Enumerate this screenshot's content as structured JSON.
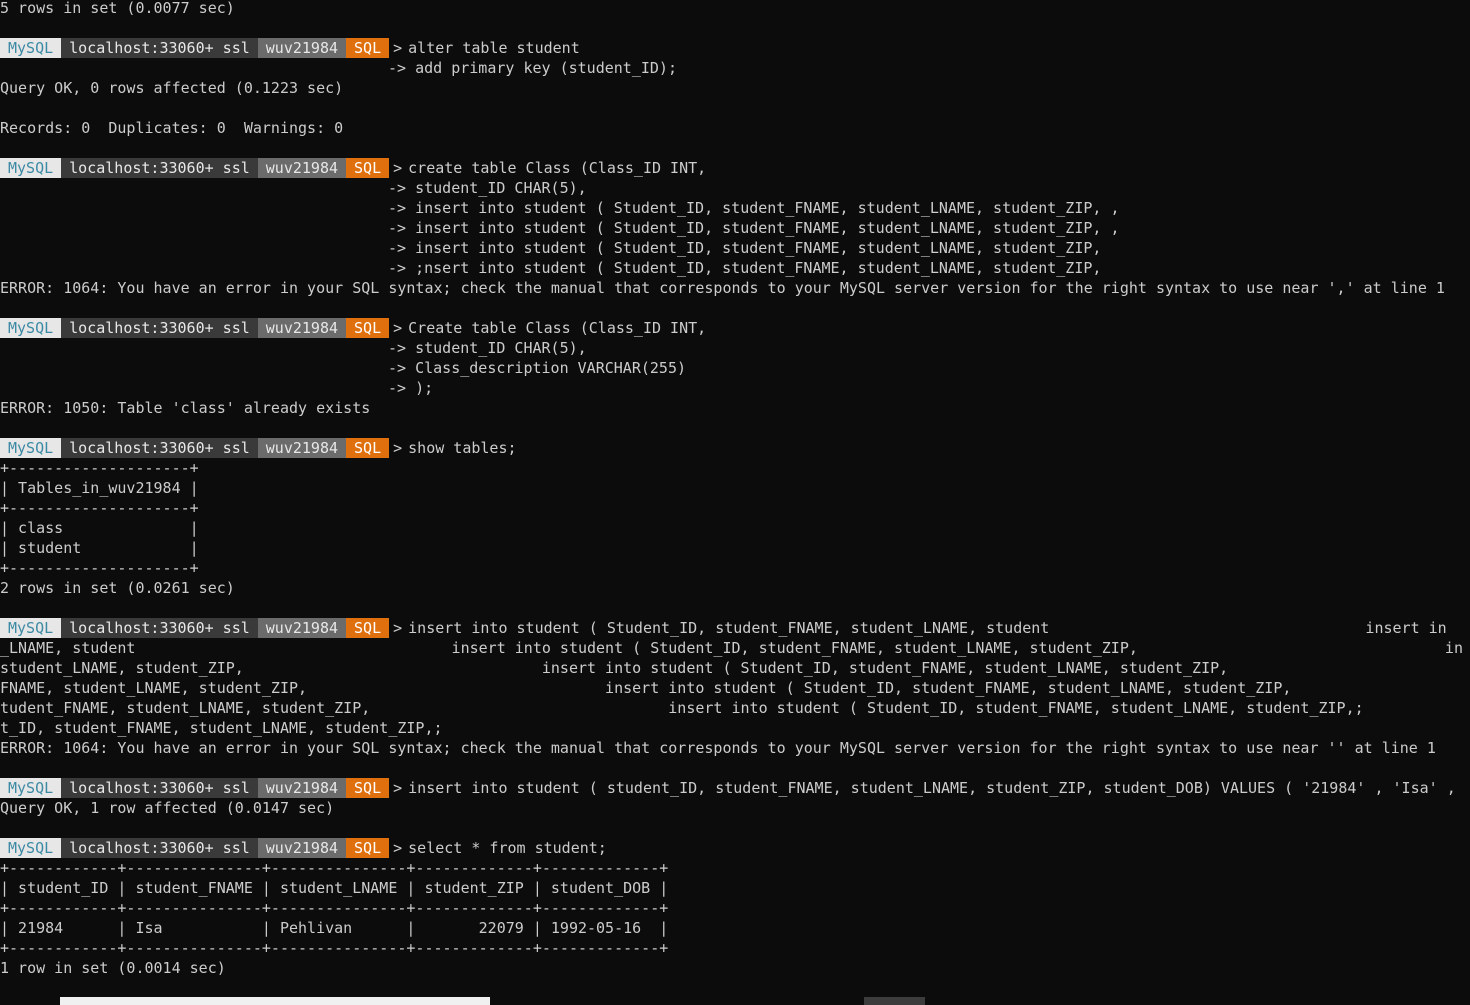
{
  "prompt": {
    "mysql": "MySQL",
    "host": "localhost:33060+ ssl",
    "schema": "wuv21984",
    "mode": "SQL",
    "arrow": ">"
  },
  "lines": [
    {
      "kind": "text",
      "text": "5 rows in set (0.0077 sec)"
    },
    {
      "kind": "blank"
    },
    {
      "kind": "prompt",
      "text": "alter table student"
    },
    {
      "kind": "cont",
      "text": "-> add primary key (student_ID);"
    },
    {
      "kind": "text",
      "text": "Query OK, 0 rows affected (0.1223 sec)"
    },
    {
      "kind": "blank"
    },
    {
      "kind": "text",
      "text": "Records: 0  Duplicates: 0  Warnings: 0"
    },
    {
      "kind": "blank"
    },
    {
      "kind": "prompt",
      "text": "create table Class (Class_ID INT,"
    },
    {
      "kind": "cont",
      "text": "-> student_ID CHAR(5),"
    },
    {
      "kind": "cont",
      "text": "-> insert into student ( Student_ID, student_FNAME, student_LNAME, student_ZIP, ,"
    },
    {
      "kind": "cont",
      "text": "-> insert into student ( Student_ID, student_FNAME, student_LNAME, student_ZIP, ,"
    },
    {
      "kind": "cont",
      "text": "-> insert into student ( Student_ID, student_FNAME, student_LNAME, student_ZIP,"
    },
    {
      "kind": "cont",
      "text": "-> ;nsert into student ( Student_ID, student_FNAME, student_LNAME, student_ZIP,"
    },
    {
      "kind": "text",
      "text": "ERROR: 1064: You have an error in your SQL syntax; check the manual that corresponds to your MySQL server version for the right syntax to use near ',' at line 1"
    },
    {
      "kind": "blank"
    },
    {
      "kind": "prompt",
      "text": "Create table Class (Class_ID INT,"
    },
    {
      "kind": "cont",
      "text": "-> student_ID CHAR(5),"
    },
    {
      "kind": "cont",
      "text": "-> Class_description VARCHAR(255)"
    },
    {
      "kind": "cont",
      "text": "-> );"
    },
    {
      "kind": "text",
      "text": "ERROR: 1050: Table 'class' already exists"
    },
    {
      "kind": "blank"
    },
    {
      "kind": "prompt",
      "text": "show tables;"
    },
    {
      "kind": "text",
      "text": "+--------------------+"
    },
    {
      "kind": "text",
      "text": "| Tables_in_wuv21984 |"
    },
    {
      "kind": "text",
      "text": "+--------------------+"
    },
    {
      "kind": "text",
      "text": "| class              |"
    },
    {
      "kind": "text",
      "text": "| student            |"
    },
    {
      "kind": "text",
      "text": "+--------------------+"
    },
    {
      "kind": "text",
      "text": "2 rows in set (0.0261 sec)"
    },
    {
      "kind": "blank"
    },
    {
      "kind": "prompt",
      "text": "insert into student ( Student_ID, student_FNAME, student_LNAME, student                                   insert in"
    },
    {
      "kind": "text",
      "text": "_LNAME, student                                   insert into student ( Student_ID, student_FNAME, student_LNAME, student_ZIP,                                  in"
    },
    {
      "kind": "text",
      "text": "student_LNAME, student_ZIP,                                 insert into student ( Student_ID, student_FNAME, student_LNAME, student_ZIP,"
    },
    {
      "kind": "text",
      "text": "FNAME, student_LNAME, student_ZIP,                                 insert into student ( Student_ID, student_FNAME, student_LNAME, student_ZIP,"
    },
    {
      "kind": "text",
      "text": "tudent_FNAME, student_LNAME, student_ZIP,                                 insert into student ( Student_ID, student_FNAME, student_LNAME, student_ZIP,;"
    },
    {
      "kind": "text",
      "text": "t_ID, student_FNAME, student_LNAME, student_ZIP,;"
    },
    {
      "kind": "text",
      "text": "ERROR: 1064: You have an error in your SQL syntax; check the manual that corresponds to your MySQL server version for the right syntax to use near '' at line 1"
    },
    {
      "kind": "blank"
    },
    {
      "kind": "prompt",
      "text": "insert into student ( student_ID, student_FNAME, student_LNAME, student_ZIP, student_DOB) VALUES ( '21984' , 'Isa' ,"
    },
    {
      "kind": "text",
      "text": "Query OK, 1 row affected (0.0147 sec)"
    },
    {
      "kind": "blank"
    },
    {
      "kind": "prompt",
      "text": "select * from student;"
    },
    {
      "kind": "text",
      "text": "+------------+---------------+---------------+-------------+-------------+"
    },
    {
      "kind": "text",
      "text": "| student_ID | student_FNAME | student_LNAME | student_ZIP | student_DOB |"
    },
    {
      "kind": "text",
      "text": "+------------+---------------+---------------+-------------+-------------+"
    },
    {
      "kind": "text",
      "text": "| 21984      | Isa           | Pehlivan      |       22079 | 1992-05-16  |"
    },
    {
      "kind": "text",
      "text": "+------------+---------------+---------------+-------------+-------------+"
    },
    {
      "kind": "text",
      "text": "1 row in set (0.0014 sec)"
    }
  ],
  "colors": {
    "background": "#0c0c0c",
    "foreground": "#cccccc",
    "mysql_bg": "#e7e7e7",
    "mysql_fg": "#3d8aa5",
    "host_bg": "#3a3a3a",
    "schema_bg": "#6b6b6b",
    "mode_bg": "#e0700e"
  }
}
